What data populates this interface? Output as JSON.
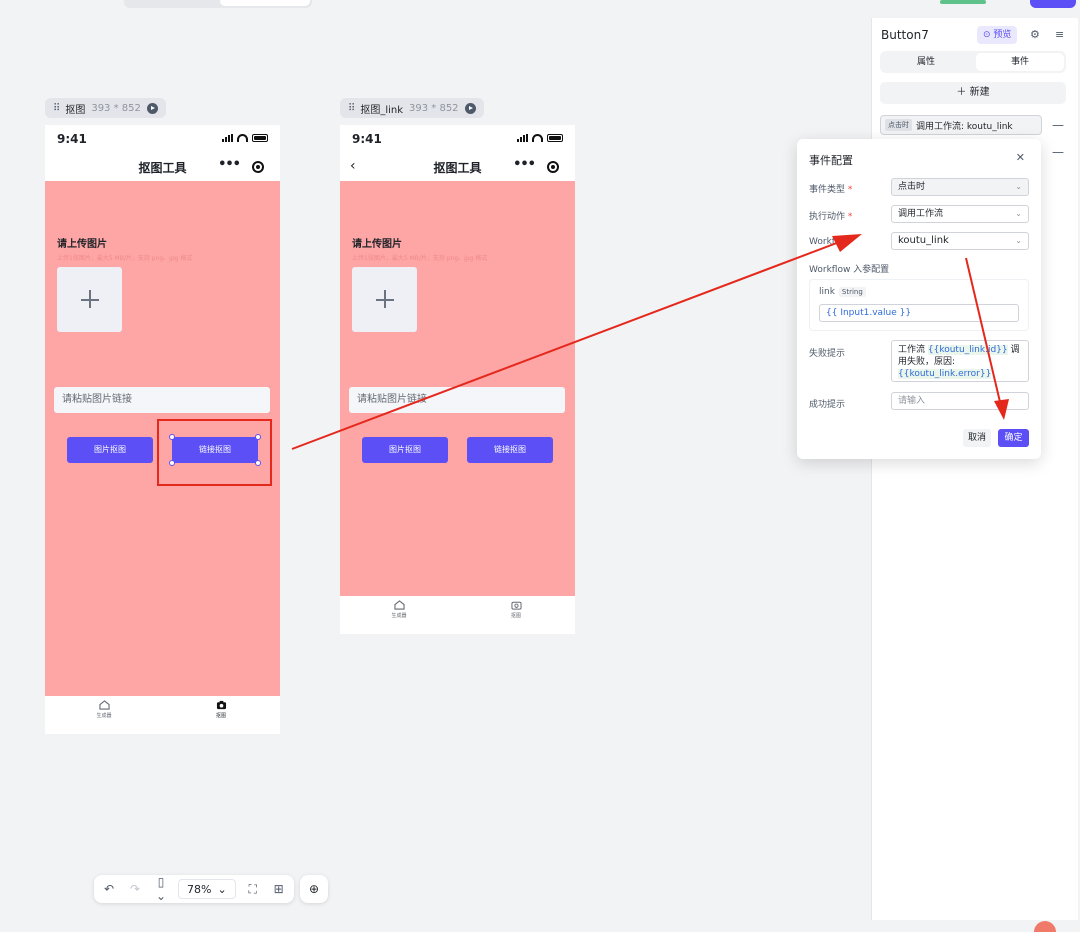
{
  "frames": [
    {
      "tag": "抠图",
      "size": "393 * 852"
    },
    {
      "tag": "抠图_link",
      "size": "393 * 852"
    }
  ],
  "phone": {
    "time": "9:41",
    "title": "抠图工具",
    "more": "•••",
    "upload_title": "请上传图片",
    "upload_hint": "上传1张图片，最大5 MB/片，支持 png、jpg 格式",
    "link_placeholder": "请粘贴图片链接",
    "btn_image": "图片抠图",
    "btn_link": "链接抠图",
    "tabs": [
      "生成器",
      "抠图"
    ]
  },
  "toolbar": {
    "zoom": "78%"
  },
  "panel": {
    "title": "Button7",
    "preview": "预览",
    "tab_props": "属性",
    "tab_events": "事件",
    "new_label": "新建",
    "event_tag": "点击时",
    "event_text": "调用工作流: koutu_link"
  },
  "modal": {
    "title": "事件配置",
    "event_type_label": "事件类型",
    "event_type_value": "点击时",
    "action_label": "执行动作",
    "action_value": "调用工作流",
    "workflow_label": "Workflow",
    "workflow_value": "koutu_link",
    "params_label": "Workflow 入参配置",
    "param_name": "link",
    "param_type": "String",
    "param_value": "{{ Input1.value }}",
    "fail_label": "失败提示",
    "fail_text_1": "工作流 ",
    "fail_hl_1": "{{koutu_link.id}}",
    "fail_text_2": " 调用失败，原因: ",
    "fail_hl_2": "{{koutu_link.error}}",
    "success_label": "成功提示",
    "success_placeholder": "请输入",
    "cancel": "取消",
    "ok": "确定"
  },
  "colors": {
    "accent": "#5b4ff5",
    "pink": "#fea5a5",
    "annotation_red": "#e5281c"
  }
}
